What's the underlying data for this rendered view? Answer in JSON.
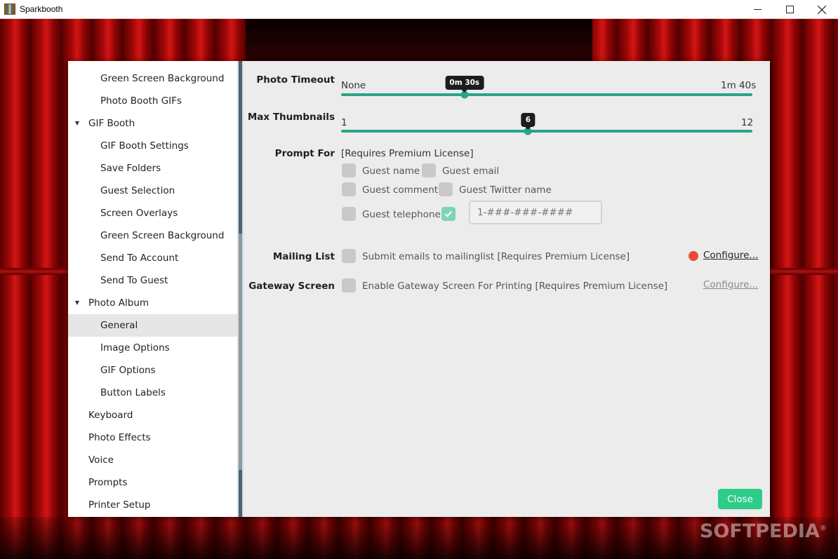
{
  "window": {
    "title": "Sparkbooth"
  },
  "sidebar": {
    "items": [
      {
        "label": "Green Screen Background"
      },
      {
        "label": "Photo Booth GIFs"
      },
      {
        "label": "GIF Booth"
      },
      {
        "label": "GIF Booth Settings"
      },
      {
        "label": "Save Folders"
      },
      {
        "label": "Guest Selection"
      },
      {
        "label": "Screen Overlays"
      },
      {
        "label": "Green Screen Background"
      },
      {
        "label": "Send To Account"
      },
      {
        "label": "Send To Guest"
      },
      {
        "label": "Photo Album"
      },
      {
        "label": "General"
      },
      {
        "label": "Image Options"
      },
      {
        "label": "GIF Options"
      },
      {
        "label": "Button Labels"
      },
      {
        "label": "Keyboard"
      },
      {
        "label": "Photo Effects"
      },
      {
        "label": "Voice"
      },
      {
        "label": "Prompts"
      },
      {
        "label": "Printer Setup"
      }
    ],
    "selected": "General"
  },
  "settings": {
    "photo_timeout": {
      "label": "Photo Timeout",
      "min_label": "None",
      "max_label": "1m 40s",
      "value_label": "0m 30s",
      "fraction": 0.3
    },
    "max_thumbnails": {
      "label": "Max Thumbnails",
      "min_label": "1",
      "max_label": "12",
      "value_label": "6",
      "value": 6,
      "min": 1,
      "max": 12
    },
    "prompt_for": {
      "label": "Prompt For",
      "note": "[Requires Premium License]",
      "options": {
        "guest_name": {
          "label": "Guest name",
          "checked": false
        },
        "guest_email": {
          "label": "Guest email",
          "checked": false
        },
        "guest_comment": {
          "label": "Guest comment",
          "checked": false
        },
        "guest_twitter": {
          "label": "Guest Twitter name",
          "checked": false
        },
        "guest_telephone": {
          "label": "Guest telephone",
          "checked": false
        },
        "format_check": {
          "checked": true
        }
      },
      "telephone_placeholder": "1-###-###-####"
    },
    "mailing_list": {
      "label": "Mailing List",
      "text": "Submit emails to mailinglist [Requires Premium License]",
      "configure_label": "Configure...",
      "status_color": "#e84b3c"
    },
    "gateway_screen": {
      "label": "Gateway Screen",
      "text": "Enable Gateway Screen For Printing [Requires Premium License]",
      "configure_label": "Configure..."
    }
  },
  "buttons": {
    "close_label": "Close"
  },
  "watermark": {
    "text": "SOFTPEDIA",
    "mark": "®"
  },
  "colors": {
    "accent": "#29a586",
    "close_button": "#2ecc89",
    "checkbox_checked": "#7ed3bb"
  }
}
